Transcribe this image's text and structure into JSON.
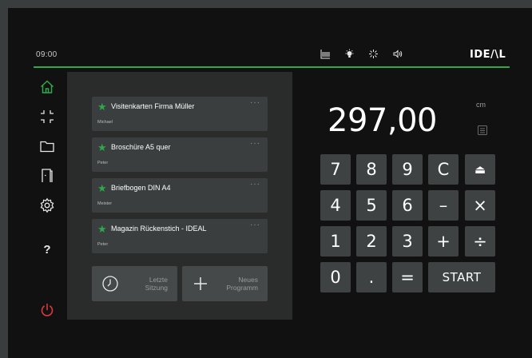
{
  "topbar": {
    "time": "09:00",
    "brand": "IDE/\\L",
    "icons": [
      "stack-icon",
      "light-icon",
      "brightness-icon",
      "sound-icon"
    ]
  },
  "nav": {
    "items": [
      "home-icon",
      "focus-icon",
      "folder-icon",
      "door-icon",
      "gear-icon",
      "help-icon",
      "power-icon"
    ],
    "help_label": "?"
  },
  "programs": [
    {
      "title": "Visitenkarten Firma Müller",
      "user": "Michael",
      "more": "···"
    },
    {
      "title": "Broschüre A5 quer",
      "user": "Peter",
      "more": "···"
    },
    {
      "title": "Briefbogen DIN A4",
      "user": "Meister",
      "more": "···"
    },
    {
      "title": "Magazin Rückenstich - IDEAL",
      "user": "Peter",
      "more": "···"
    }
  ],
  "actions": {
    "last_session": {
      "line1": "Letzte",
      "line2": "Sitzung"
    },
    "new_program": {
      "line1": "Neues",
      "line2": "Programm"
    }
  },
  "display": {
    "value": "297,00",
    "unit": "cm"
  },
  "keypad": {
    "rows": [
      [
        "7",
        "8",
        "9",
        "C",
        "⏏"
      ],
      [
        "4",
        "5",
        "6",
        "–",
        "×"
      ],
      [
        "1",
        "2",
        "3",
        "+",
        "÷"
      ],
      [
        "0",
        ".",
        "=",
        "START"
      ]
    ]
  },
  "colors": {
    "accent": "#2ea84a",
    "power": "#d93a3a",
    "background": "#111111",
    "panel": "#2a2c2c",
    "key": "#3e4243"
  }
}
